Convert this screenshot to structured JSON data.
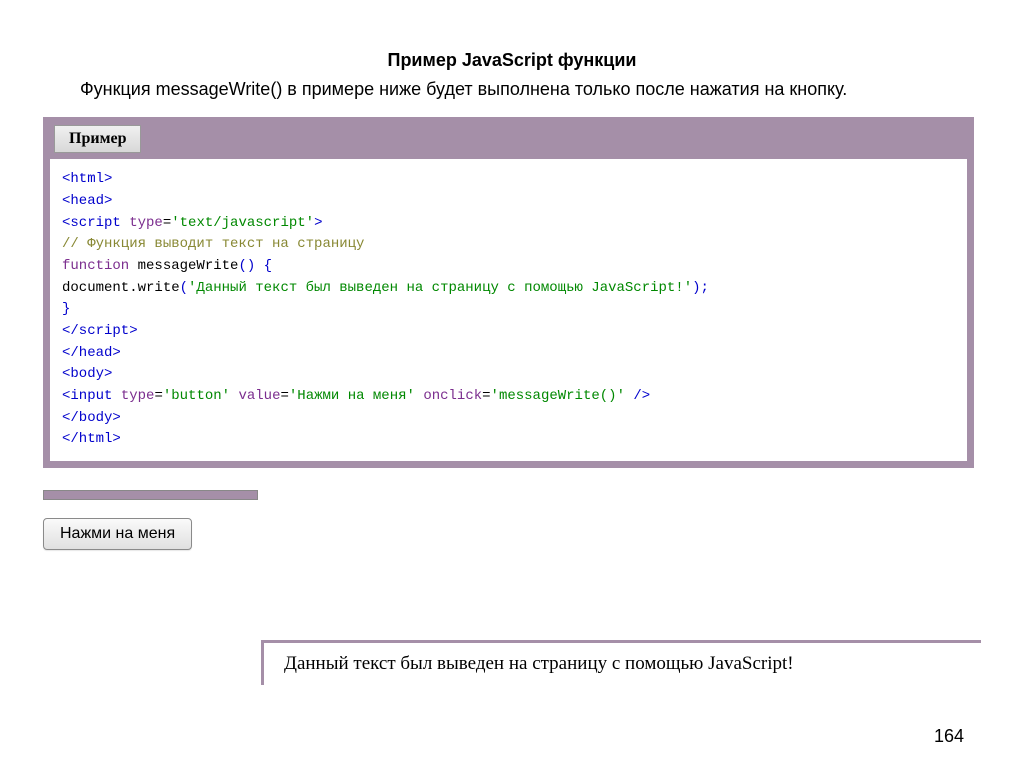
{
  "header": {
    "title": "Пример JavaScript функции",
    "description": "Функция messageWrite() в примере ниже будет выполнена только после нажатия на кнопку."
  },
  "example": {
    "tab_label": "Пример",
    "code": {
      "l1a": "<html>",
      "l2a": "<head>",
      "l3a": "<script",
      "l3b": " type",
      "l3c": "=",
      "l3d": "'text/javascript'",
      "l3e": ">",
      "l4a": "// Функция выводит текст на страницу",
      "l5a": "function",
      "l5b": " messageWrite",
      "l5c": "() {",
      "l6a": "     document.write",
      "l6b": "(",
      "l6c": "'Данный текст был выведен на страницу с помощью JavaScript!'",
      "l6d": ");",
      "l7a": "}",
      "l8a": "</script",
      "l8b": ">",
      "l9a": "</head>",
      "l10a": "<body>",
      "l11a": "<input",
      "l11b": " type",
      "l11c": "=",
      "l11d": "'button'",
      "l11e": " value",
      "l11f": "=",
      "l11g": "'Нажми на меня'",
      "l11h": " onclick",
      "l11i": "=",
      "l11j": "'messageWrite()'",
      "l11k": " />",
      "l12a": "</body>",
      "l13a": "</html>"
    }
  },
  "button": {
    "label": "Нажми на меня"
  },
  "output": {
    "text": "Данный текст был выведен на страницу с помощью JavaScript!"
  },
  "page_number": "164"
}
